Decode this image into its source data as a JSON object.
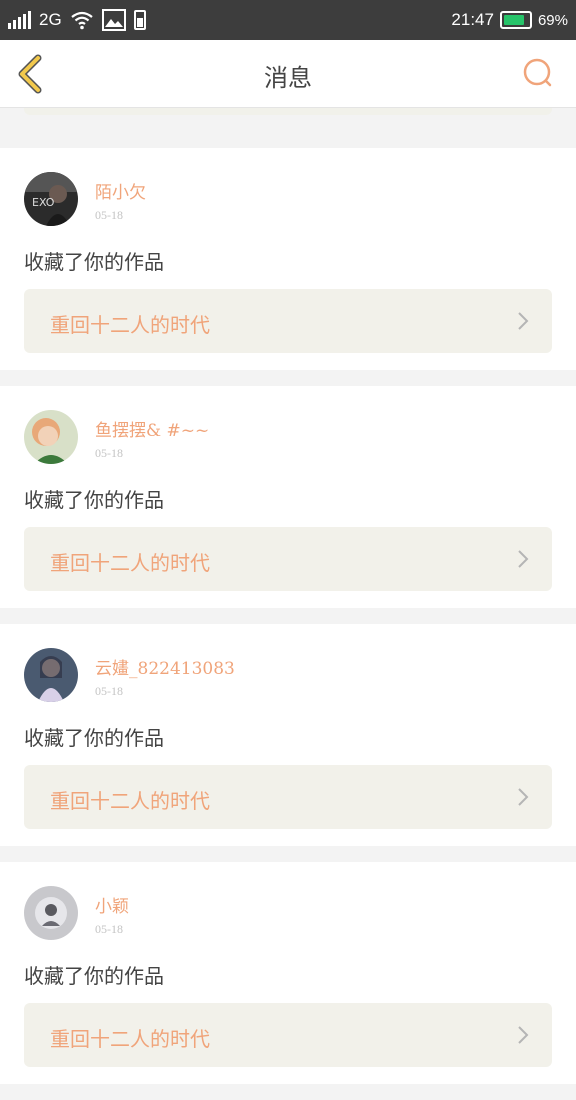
{
  "status_bar": {
    "network": "2G",
    "time": "21:47",
    "battery": "69%",
    "icons": [
      "signal-icon",
      "wifi-icon",
      "image-icon",
      "battery-icon"
    ]
  },
  "header": {
    "title": "消息",
    "back_icon": "back-arrow-icon",
    "search_icon": "search-icon"
  },
  "colors": {
    "accent": "#f0a47a",
    "back_arrow": "#f2c94c",
    "status_bar": "#3d3d3d",
    "card_box": "#f2f1ea"
  },
  "messages": [
    {
      "username": "陌小欠",
      "date": "05-18",
      "action": "收藏了你的作品",
      "work_title": "重回十二人的时代"
    },
    {
      "username": "鱼摆摆& #~~",
      "date": "05-18",
      "action": "收藏了你的作品",
      "work_title": "重回十二人的时代"
    },
    {
      "username": "云嫿_822413083",
      "date": "05-18",
      "action": "收藏了你的作品",
      "work_title": "重回十二人的时代"
    },
    {
      "username": "小颖",
      "date": "05-18",
      "action": "收藏了你的作品",
      "work_title": "重回十二人的时代"
    }
  ]
}
